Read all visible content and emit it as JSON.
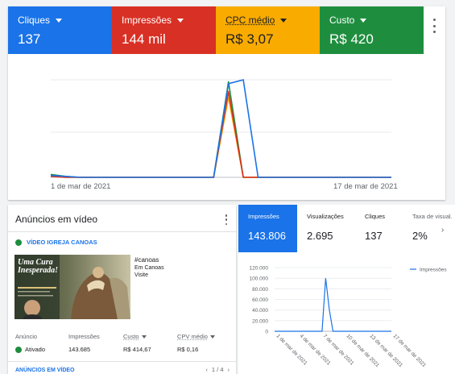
{
  "metrics": [
    {
      "label": "Cliques",
      "value": "137"
    },
    {
      "label": "Impressões",
      "value": "144 mil"
    },
    {
      "label": "CPC médio",
      "value": "R$ 3,07"
    },
    {
      "label": "Custo",
      "value": "R$ 420"
    }
  ],
  "colors": {
    "blue": "#1a73e8",
    "red": "#d93025",
    "yellow": "#f9ab00",
    "green": "#1e8e3e"
  },
  "main_chart_data": {
    "type": "line",
    "x_start_label": "1 de mar de 2021",
    "x_end_label": "17 de mar de 2021",
    "series": [
      {
        "color": "#1a73e8",
        "values": [
          0.02,
          0.01,
          0.0,
          0.0,
          0.0,
          0.0,
          0.0,
          0.0,
          0.0,
          0.0,
          0.0,
          0.0,
          0.96,
          1.0,
          0.0,
          0.0,
          0.0,
          0.0,
          0.0,
          0.0,
          0.0,
          0.0,
          0.0,
          0.0
        ]
      },
      {
        "color": "#d93025",
        "values": [
          0.01,
          0.0,
          0.0,
          0.0,
          0.0,
          0.0,
          0.0,
          0.0,
          0.0,
          0.0,
          0.0,
          0.0,
          0.88,
          0.0,
          0.0,
          0.0,
          0.0,
          0.0,
          0.0,
          0.0,
          0.0,
          0.0,
          0.0,
          0.0
        ]
      },
      {
        "color": "#f9ab00",
        "values": [
          0.01,
          0.0,
          0.0,
          0.0,
          0.0,
          0.0,
          0.0,
          0.0,
          0.0,
          0.0,
          0.0,
          0.0,
          0.82,
          0.0,
          0.0,
          0.0,
          0.0,
          0.0,
          0.0,
          0.0,
          0.0,
          0.0,
          0.0,
          0.0
        ]
      },
      {
        "color": "#1e8e3e",
        "values": [
          0.03,
          0.01,
          0.0,
          0.0,
          0.0,
          0.0,
          0.0,
          0.0,
          0.0,
          0.0,
          0.0,
          0.0,
          0.98,
          0.0,
          0.0,
          0.0,
          0.0,
          0.0,
          0.0,
          0.0,
          0.0,
          0.0,
          0.0,
          0.0
        ]
      }
    ]
  },
  "ads": {
    "title": "Anúncios em vídeo",
    "video_name": "VÍDEO IGREJA CANOAS",
    "thumb_title_1": "Uma Cura",
    "thumb_title_2": "Inesperada!",
    "video_hashtag": "#canoas",
    "video_line2": "Em Canoas",
    "video_line3": "Visite",
    "columns": [
      "Anúncio",
      "Impressões",
      "Custo",
      "CPV médio"
    ],
    "row": {
      "status": "Ativado",
      "impressions": "143.685",
      "cost": "R$ 414,67",
      "cpv": "R$ 0,16"
    },
    "footer_link": "ANÚNCIOS EM VÍDEO",
    "pager": "1 / 4"
  },
  "stats": {
    "tiles": [
      {
        "label": "Impressões",
        "value": "143.806"
      },
      {
        "label": "Visualizações",
        "value": "2.695"
      },
      {
        "label": "Cliques",
        "value": "137"
      },
      {
        "label": "Taxa de visual.",
        "value": "2%"
      }
    ]
  },
  "chart_data": {
    "type": "line",
    "legend": "Impressões",
    "legend_position": "top-right",
    "y_ticks": [
      "120.000",
      "100.000",
      "80.000",
      "60.000",
      "40.000",
      "20.000",
      "0"
    ],
    "ylim": [
      0,
      120000
    ],
    "x_ticks": [
      "1 de mar de 2021",
      "4 de mar de 2021",
      "7 de mar de 2021",
      "10 de mar de 2021",
      "13 de mar de 2021",
      "17 de mar de 2021"
    ],
    "series": [
      {
        "name": "Impressões",
        "color": "#1a73e8",
        "values": [
          0,
          0,
          0,
          0,
          0,
          0,
          0,
          0,
          0,
          0,
          0,
          0,
          0,
          0,
          100000,
          40000,
          0,
          0,
          0,
          0,
          0,
          0,
          0,
          0,
          0,
          0,
          0,
          0,
          0,
          0,
          0,
          0,
          0
        ]
      }
    ]
  }
}
